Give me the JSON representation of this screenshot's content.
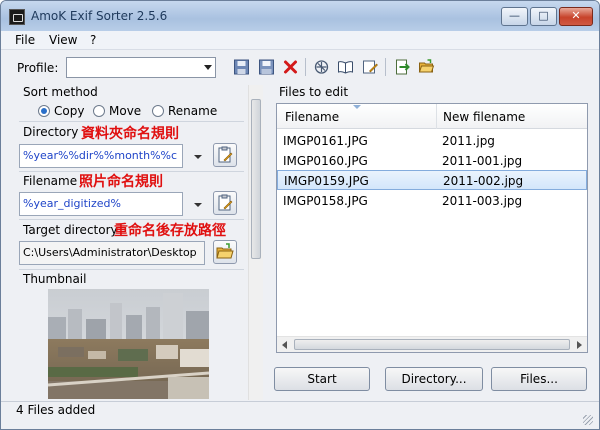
{
  "window": {
    "title": "AmoK Exif Sorter 2.5.6"
  },
  "menu": {
    "items": [
      "File",
      "View",
      "?"
    ]
  },
  "toolbar": {
    "profile_label": "Profile:",
    "profile_value": "",
    "icons": [
      "save-disk-icon",
      "save-as-icon",
      "delete-x-icon",
      "settings-icon",
      "book-icon",
      "edit-icon",
      "export-icon",
      "open-folder-icon"
    ]
  },
  "sort_method": {
    "label": "Sort method",
    "options": [
      "Copy",
      "Move",
      "Rename"
    ],
    "selected": "Copy"
  },
  "directory": {
    "label": "Directory",
    "note": "資料夾命名規則",
    "value": "%year%%dir%%month%%c"
  },
  "filename": {
    "label": "Filename",
    "note": "照片命名規則",
    "value": "%year_digitized%"
  },
  "target_directory": {
    "label": "Target directory",
    "note": "重命名後存放路徑",
    "value": "C:\\Users\\Administrator\\Desktop"
  },
  "thumbnail": {
    "label": "Thumbnail"
  },
  "files": {
    "label": "Files to edit",
    "columns": [
      "Filename",
      "New filename"
    ],
    "rows": [
      {
        "filename": "IMGP0161.JPG",
        "new_filename": "2011.jpg"
      },
      {
        "filename": "IMGP0160.JPG",
        "new_filename": "2011-001.jpg"
      },
      {
        "filename": "IMGP0159.JPG",
        "new_filename": "2011-002.jpg"
      },
      {
        "filename": "IMGP0158.JPG",
        "new_filename": "2011-003.jpg"
      }
    ],
    "selected_index": 2
  },
  "buttons": {
    "start": "Start",
    "directory": "Directory...",
    "files": "Files..."
  },
  "status": {
    "text": "4 Files added"
  },
  "colors": {
    "annotation": "#e01010",
    "input_text": "#1f44c8",
    "selection": "#d3e6fb"
  }
}
